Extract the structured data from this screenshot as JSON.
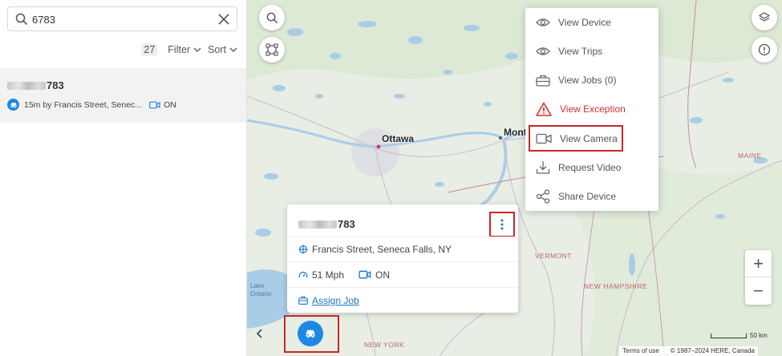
{
  "search": {
    "value": "6783",
    "placeholder": ""
  },
  "toolbar": {
    "count": "27",
    "filter_label": "Filter",
    "sort_label": "Sort"
  },
  "result": {
    "name_suffix": "783",
    "meta_text": "15m by Francis Street, Senec...",
    "camera_status": "ON"
  },
  "map": {
    "labels": {
      "ottawa": "Ottawa",
      "montreal": "Mont",
      "maine": "MAINE",
      "vermont": "VERMONT",
      "new_hampshire": "NEW HAMPSHIRE",
      "new_york": "NEW YORK",
      "lake_line1": "Lake",
      "lake_line2": "Ontario"
    },
    "scale": "50 km",
    "attribution_terms": "Terms of use",
    "attribution_copyright": "© 1987–2024 HERE, Canada"
  },
  "card": {
    "name_suffix": "783",
    "location": "Francis Street, Seneca Falls, NY",
    "speed": "51 Mph",
    "camera_status": "ON",
    "assign_job": "Assign Job"
  },
  "menu": {
    "items": [
      {
        "label": "View Device",
        "icon": "eye-icon"
      },
      {
        "label": "View Trips",
        "icon": "eye-icon"
      },
      {
        "label": "View Jobs (0)",
        "icon": "briefcase-icon"
      },
      {
        "label": "View Exception",
        "icon": "warning-icon"
      },
      {
        "label": "View Camera",
        "icon": "video-camera-icon"
      },
      {
        "label": "Request Video",
        "icon": "download-icon"
      },
      {
        "label": "Share Device",
        "icon": "share-icon"
      }
    ]
  },
  "colors": {
    "accent": "#1e88e5",
    "danger": "#d32f2f",
    "highlight": "#c62828"
  }
}
